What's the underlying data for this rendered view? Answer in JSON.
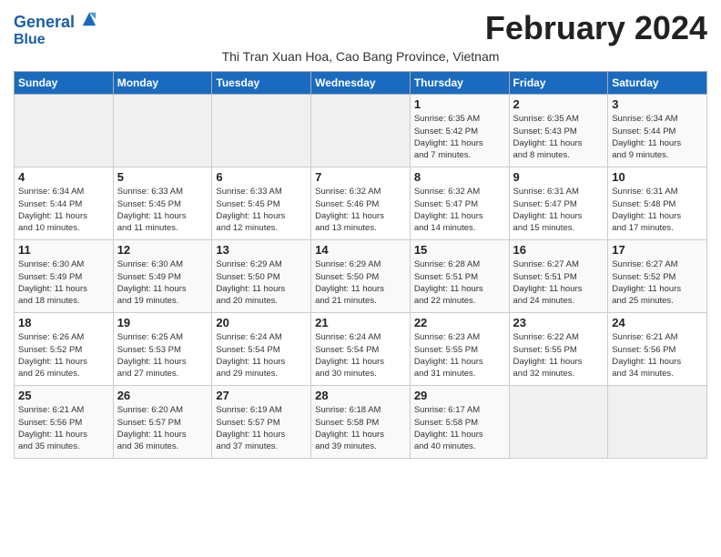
{
  "header": {
    "logo_line1": "General",
    "logo_line2": "Blue",
    "title": "February 2024",
    "subtitle": "Thi Tran Xuan Hoa, Cao Bang Province, Vietnam"
  },
  "weekdays": [
    "Sunday",
    "Monday",
    "Tuesday",
    "Wednesday",
    "Thursday",
    "Friday",
    "Saturday"
  ],
  "weeks": [
    [
      {
        "day": "",
        "info": ""
      },
      {
        "day": "",
        "info": ""
      },
      {
        "day": "",
        "info": ""
      },
      {
        "day": "",
        "info": ""
      },
      {
        "day": "1",
        "info": "Sunrise: 6:35 AM\nSunset: 5:42 PM\nDaylight: 11 hours\nand 7 minutes."
      },
      {
        "day": "2",
        "info": "Sunrise: 6:35 AM\nSunset: 5:43 PM\nDaylight: 11 hours\nand 8 minutes."
      },
      {
        "day": "3",
        "info": "Sunrise: 6:34 AM\nSunset: 5:44 PM\nDaylight: 11 hours\nand 9 minutes."
      }
    ],
    [
      {
        "day": "4",
        "info": "Sunrise: 6:34 AM\nSunset: 5:44 PM\nDaylight: 11 hours\nand 10 minutes."
      },
      {
        "day": "5",
        "info": "Sunrise: 6:33 AM\nSunset: 5:45 PM\nDaylight: 11 hours\nand 11 minutes."
      },
      {
        "day": "6",
        "info": "Sunrise: 6:33 AM\nSunset: 5:45 PM\nDaylight: 11 hours\nand 12 minutes."
      },
      {
        "day": "7",
        "info": "Sunrise: 6:32 AM\nSunset: 5:46 PM\nDaylight: 11 hours\nand 13 minutes."
      },
      {
        "day": "8",
        "info": "Sunrise: 6:32 AM\nSunset: 5:47 PM\nDaylight: 11 hours\nand 14 minutes."
      },
      {
        "day": "9",
        "info": "Sunrise: 6:31 AM\nSunset: 5:47 PM\nDaylight: 11 hours\nand 15 minutes."
      },
      {
        "day": "10",
        "info": "Sunrise: 6:31 AM\nSunset: 5:48 PM\nDaylight: 11 hours\nand 17 minutes."
      }
    ],
    [
      {
        "day": "11",
        "info": "Sunrise: 6:30 AM\nSunset: 5:49 PM\nDaylight: 11 hours\nand 18 minutes."
      },
      {
        "day": "12",
        "info": "Sunrise: 6:30 AM\nSunset: 5:49 PM\nDaylight: 11 hours\nand 19 minutes."
      },
      {
        "day": "13",
        "info": "Sunrise: 6:29 AM\nSunset: 5:50 PM\nDaylight: 11 hours\nand 20 minutes."
      },
      {
        "day": "14",
        "info": "Sunrise: 6:29 AM\nSunset: 5:50 PM\nDaylight: 11 hours\nand 21 minutes."
      },
      {
        "day": "15",
        "info": "Sunrise: 6:28 AM\nSunset: 5:51 PM\nDaylight: 11 hours\nand 22 minutes."
      },
      {
        "day": "16",
        "info": "Sunrise: 6:27 AM\nSunset: 5:51 PM\nDaylight: 11 hours\nand 24 minutes."
      },
      {
        "day": "17",
        "info": "Sunrise: 6:27 AM\nSunset: 5:52 PM\nDaylight: 11 hours\nand 25 minutes."
      }
    ],
    [
      {
        "day": "18",
        "info": "Sunrise: 6:26 AM\nSunset: 5:52 PM\nDaylight: 11 hours\nand 26 minutes."
      },
      {
        "day": "19",
        "info": "Sunrise: 6:25 AM\nSunset: 5:53 PM\nDaylight: 11 hours\nand 27 minutes."
      },
      {
        "day": "20",
        "info": "Sunrise: 6:24 AM\nSunset: 5:54 PM\nDaylight: 11 hours\nand 29 minutes."
      },
      {
        "day": "21",
        "info": "Sunrise: 6:24 AM\nSunset: 5:54 PM\nDaylight: 11 hours\nand 30 minutes."
      },
      {
        "day": "22",
        "info": "Sunrise: 6:23 AM\nSunset: 5:55 PM\nDaylight: 11 hours\nand 31 minutes."
      },
      {
        "day": "23",
        "info": "Sunrise: 6:22 AM\nSunset: 5:55 PM\nDaylight: 11 hours\nand 32 minutes."
      },
      {
        "day": "24",
        "info": "Sunrise: 6:21 AM\nSunset: 5:56 PM\nDaylight: 11 hours\nand 34 minutes."
      }
    ],
    [
      {
        "day": "25",
        "info": "Sunrise: 6:21 AM\nSunset: 5:56 PM\nDaylight: 11 hours\nand 35 minutes."
      },
      {
        "day": "26",
        "info": "Sunrise: 6:20 AM\nSunset: 5:57 PM\nDaylight: 11 hours\nand 36 minutes."
      },
      {
        "day": "27",
        "info": "Sunrise: 6:19 AM\nSunset: 5:57 PM\nDaylight: 11 hours\nand 37 minutes."
      },
      {
        "day": "28",
        "info": "Sunrise: 6:18 AM\nSunset: 5:58 PM\nDaylight: 11 hours\nand 39 minutes."
      },
      {
        "day": "29",
        "info": "Sunrise: 6:17 AM\nSunset: 5:58 PM\nDaylight: 11 hours\nand 40 minutes."
      },
      {
        "day": "",
        "info": ""
      },
      {
        "day": "",
        "info": ""
      }
    ]
  ]
}
